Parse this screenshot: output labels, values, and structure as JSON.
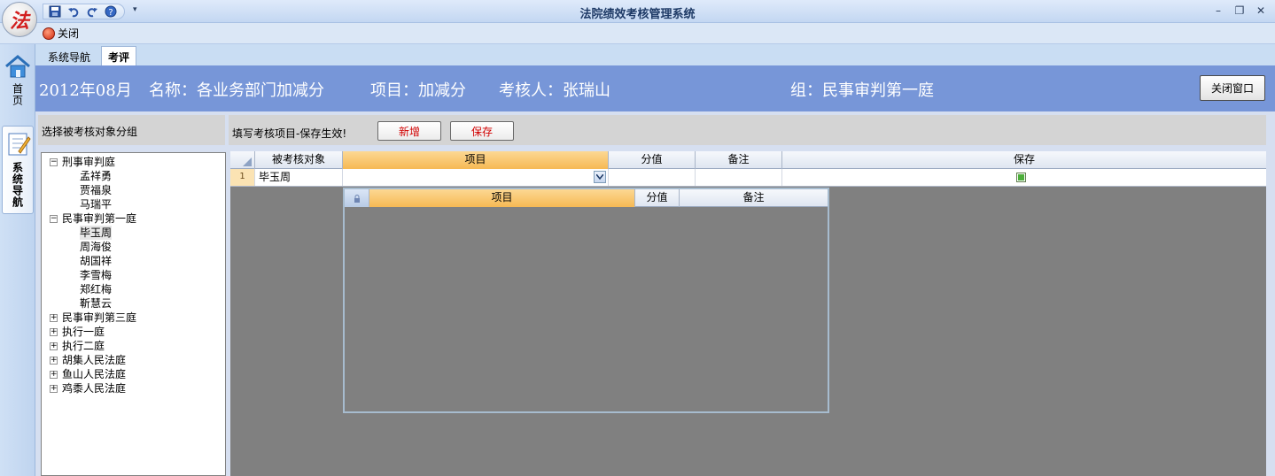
{
  "app": {
    "title": "法院绩效考核管理系统",
    "logo_char": "法"
  },
  "toolbar": {
    "close_label": "关闭"
  },
  "left_nav": {
    "home_label": "首页",
    "sys_nav_label": "系统导航"
  },
  "tabs": [
    {
      "label": "系统导航",
      "active": false
    },
    {
      "label": "考评",
      "active": true
    }
  ],
  "banner": {
    "period": "2012年08月",
    "name": "名称：各业务部门加减分",
    "item": "项目：加减分",
    "reviewer": "考核人：张瑞山",
    "group": "组：民事审判第一庭",
    "close_window_label": "关闭窗口"
  },
  "left_panel": {
    "header": "选择被考核对象分组",
    "tree": [
      {
        "label": "刑事审判庭",
        "expanded": true,
        "children": [
          "孟祥勇",
          "贾福泉",
          "马瑞平"
        ]
      },
      {
        "label": "民事审判第一庭",
        "expanded": true,
        "children": [
          "毕玉周",
          "周海俊",
          "胡国祥",
          "李雪梅",
          "郑红梅",
          "靳慧云"
        ],
        "selected_child": "毕玉周"
      },
      {
        "label": "民事审判第三庭",
        "expanded": false
      },
      {
        "label": "执行一庭",
        "expanded": false
      },
      {
        "label": "执行二庭",
        "expanded": false
      },
      {
        "label": "胡集人民法庭",
        "expanded": false
      },
      {
        "label": "鱼山人民法庭",
        "expanded": false
      },
      {
        "label": "鸡黍人民法庭",
        "expanded": false
      }
    ]
  },
  "right_panel": {
    "hint": "填写考核项目-保存生效!",
    "add_label": "新增",
    "save_label": "保存",
    "grid": {
      "columns": [
        "被考核对象",
        "项目",
        "分值",
        "备注",
        "保存"
      ],
      "rows": [
        {
          "num": "1",
          "target": "毕玉周",
          "item": "",
          "score": "",
          "note": "",
          "saved": true
        }
      ]
    },
    "dropdown": {
      "columns": [
        "项目",
        "分值",
        "备注"
      ]
    }
  },
  "colors": {
    "banner": "#7796d8",
    "header_orange": "#f6b954",
    "button_text": "#d10000"
  }
}
